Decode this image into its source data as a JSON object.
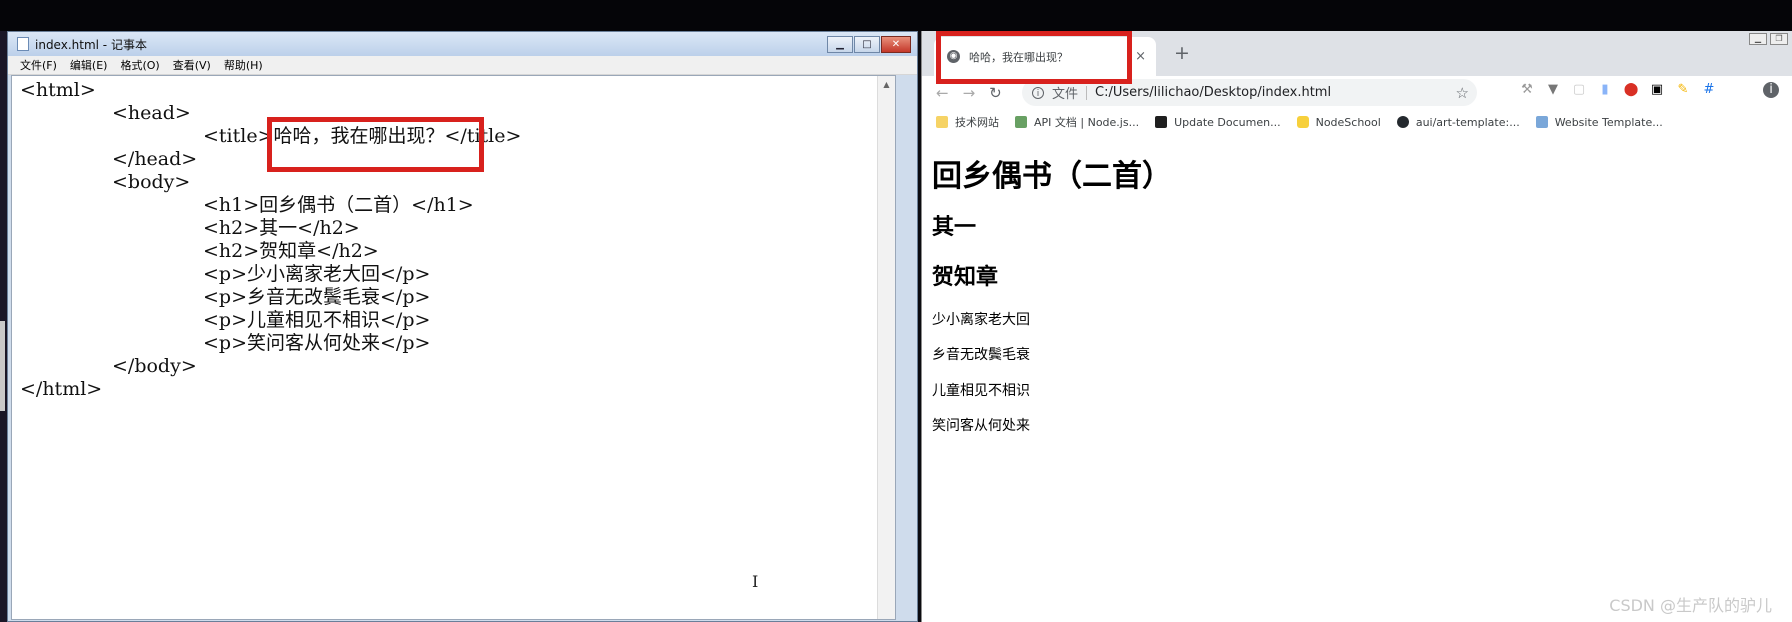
{
  "notepad": {
    "title": "index.html - 记事本",
    "menu": [
      "文件(F)",
      "编辑(E)",
      "格式(O)",
      "查看(V)",
      "帮助(H)"
    ],
    "code_lines": [
      "<html>",
      "<head>",
      "<title>哈哈，我在哪出现？</title>",
      "</head>",
      "<body>",
      "<h1>回乡偶书（二首）</h1>",
      "<h2>其一</h2>",
      "<h2>贺知章</h2>",
      "<p>少小离家老大回</p>",
      "<p>乡音无改鬓毛衰</p>",
      "<p>儿童相见不相识</p>",
      "<p>笑问客从何处来</p>",
      "</body>",
      "</html>"
    ]
  },
  "browser": {
    "tab_title": "哈哈，我在哪出现？",
    "tab_close": "×",
    "new_tab": "+",
    "scheme_label": "文件",
    "url": "C:/Users/lilichao/Desktop/index.html",
    "bookmarks": [
      "技术网站",
      "API 文档 | Node.js...",
      "Update Documen...",
      "NodeSchool",
      "aui/art-template:...",
      "Website Template..."
    ]
  },
  "page": {
    "h1": "回乡偶书（二首）",
    "h2_1": "其一",
    "h2_2": "贺知章",
    "paragraphs": [
      "少小离家老大回",
      "乡音无改鬓毛衰",
      "儿童相见不相识",
      "笑问客从何处来"
    ]
  },
  "watermark": "CSDN @生产队的驴儿",
  "colors": {
    "highlight": "#d8211d",
    "chrome_tabstrip": "#dee1e6",
    "notepad_titlebar": "#bcd0ea"
  },
  "icons": {
    "tab_favicon": "globe-icon",
    "star": "star-icon",
    "info": "info-icon"
  }
}
